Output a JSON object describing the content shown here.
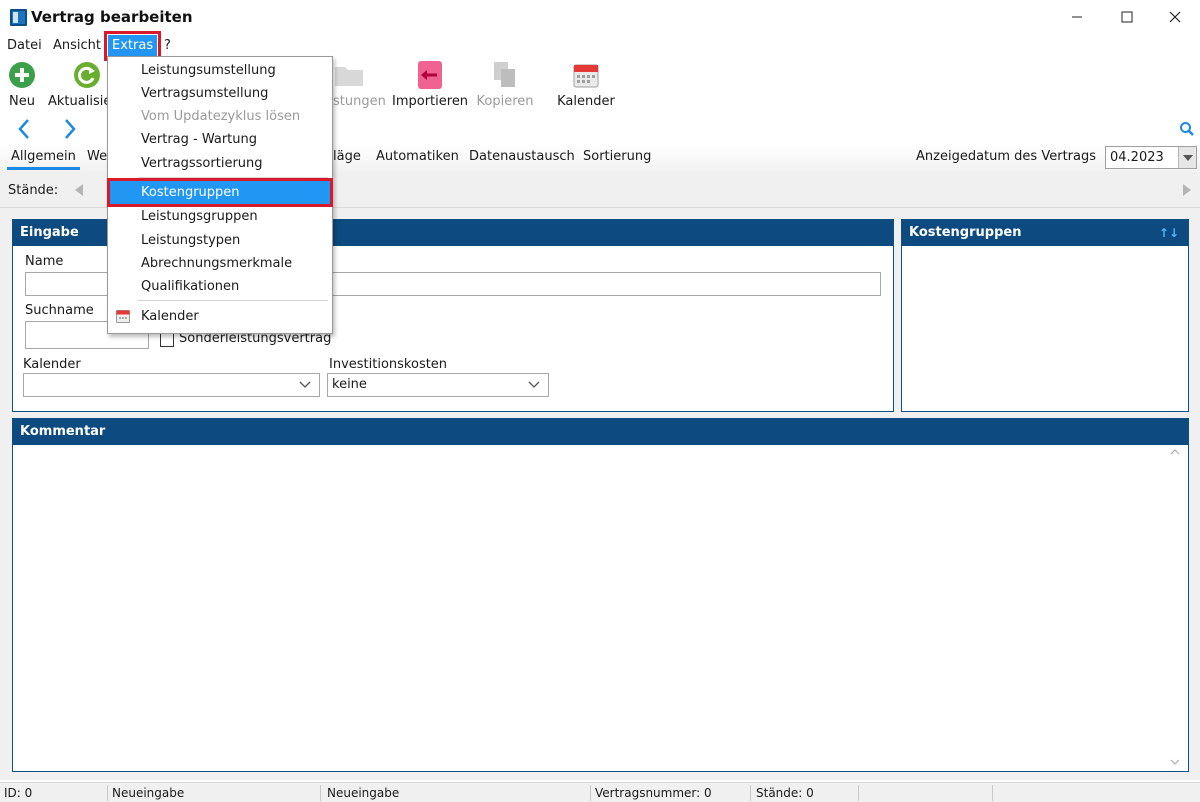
{
  "window": {
    "title": "Vertrag bearbeiten"
  },
  "menubar": {
    "datei": "Datei",
    "ansicht": "Ansicht",
    "extras": "Extras",
    "help": "?"
  },
  "toolbar": {
    "neu": "Neu",
    "aktualisieren": "Aktualisie",
    "leistungen": "stungen",
    "importieren": "Importieren",
    "kopieren": "Kopieren",
    "kalender": "Kalender"
  },
  "tabs": [
    {
      "label": "Allgemein"
    },
    {
      "label": "We"
    },
    {
      "label": "läge"
    },
    {
      "label": "Automatiken"
    },
    {
      "label": "Datenaustausch"
    },
    {
      "label": "Sortierung"
    }
  ],
  "anzeigedatum": {
    "label": "Anzeigedatum des Vertrags",
    "value": "04.2023"
  },
  "staende": {
    "label": "Stände:"
  },
  "eingabe": {
    "header": "Eingabe",
    "name_label": "Name",
    "name_value": "",
    "suchname_label": "Suchname",
    "suchname_value": "",
    "sonderleistung_label": "Sonderleistungsvertrag",
    "kalender_label": "Kalender",
    "kalender_value": "",
    "investitionskosten_label": "Investitionskosten",
    "investitionskosten_value": "keine"
  },
  "kostengruppen_panel": {
    "header": "Kostengruppen",
    "sort_glyph": "↑↓"
  },
  "kommentar": {
    "header": "Kommentar"
  },
  "extras_menu": {
    "items": [
      {
        "label": "Leistungsumstellung",
        "enabled": true
      },
      {
        "label": "Vertragsumstellung",
        "enabled": true
      },
      {
        "label": "Vom Updatezyklus lösen",
        "enabled": false
      },
      {
        "label": "Vertrag - Wartung",
        "enabled": true
      },
      {
        "label": "Vertragssortierung",
        "enabled": true
      },
      {
        "label": "Kostengruppen",
        "enabled": true,
        "highlighted": true
      },
      {
        "label": "Leistungsgruppen",
        "enabled": true
      },
      {
        "label": "Leistungstypen",
        "enabled": true
      },
      {
        "label": "Abrechnungsmerkmale",
        "enabled": true
      },
      {
        "label": "Qualifikationen",
        "enabled": true
      },
      {
        "label": "Kalender",
        "enabled": true,
        "icon": "calendar-icon"
      }
    ]
  },
  "statusbar": {
    "id": "ID: 0",
    "status1": "Neueingabe",
    "status2": "Neueingabe",
    "vertragsnummer": "Vertragsnummer: 0",
    "staende": "Stände: 0"
  },
  "colors": {
    "panel_header": "#0d4a7f",
    "highlight": "#2196f3",
    "annotation_red": "#d91a2a"
  }
}
